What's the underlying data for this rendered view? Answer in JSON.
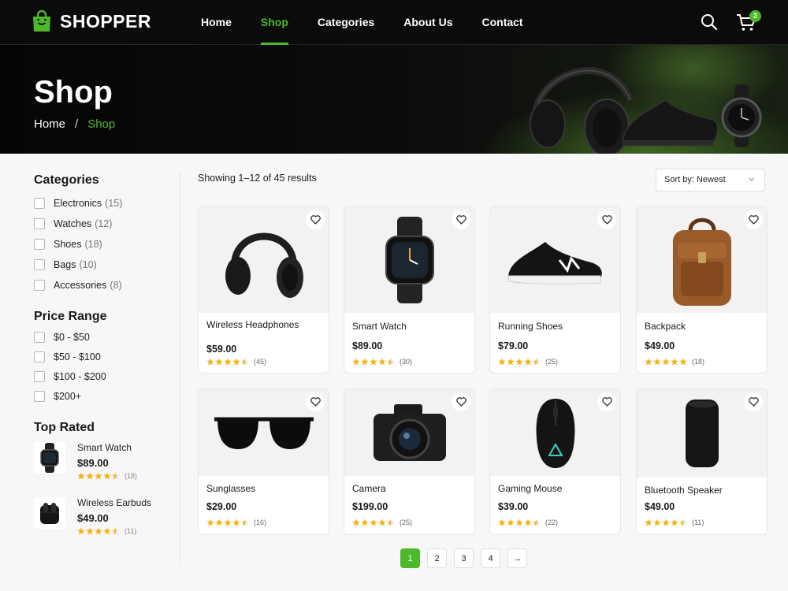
{
  "brand": {
    "name": "SHOPPER",
    "accent": "#4cb82c",
    "logo_icon": "shopping-bag-icon"
  },
  "nav": {
    "items": [
      "Home",
      "Shop",
      "Categories",
      "About Us",
      "Contact"
    ],
    "active": "Shop"
  },
  "header_icons": {
    "search": "search-icon",
    "cart": "cart-icon",
    "cart_count": "2"
  },
  "hero": {
    "title": "Shop",
    "breadcrumb": {
      "home": "Home",
      "separator": "/",
      "current": "Shop"
    }
  },
  "sidebar": {
    "categories_title": "Categories",
    "categories": [
      {
        "label": "Electronics",
        "count": "(15)"
      },
      {
        "label": "Watches",
        "count": "(12)"
      },
      {
        "label": "Shoes",
        "count": "(18)"
      },
      {
        "label": "Bags",
        "count": "(10)"
      },
      {
        "label": "Accessories",
        "count": "(8)"
      }
    ],
    "price_title": "Price Range",
    "prices": [
      "$0 - $50",
      "$50 - $100",
      "$100 - $200",
      "$200+"
    ],
    "top_rated_title": "Top Rated",
    "top_rated": [
      {
        "name": "Smart Watch",
        "price": "$89.00",
        "rating": 4.5,
        "reviews": "(18)",
        "icon": "smartwatch-icon"
      },
      {
        "name": "Wireless Earbuds",
        "price": "$49.00",
        "rating": 4.5,
        "reviews": "(11)",
        "icon": "earbuds-icon"
      }
    ]
  },
  "toolbar": {
    "showing": "Showing 1–12 of 45 results",
    "sort_label": "Sort by: Newest"
  },
  "products": [
    {
      "name": "Wireless Headphones",
      "price": "$59.00",
      "rating": 4.5,
      "reviews": "(45)",
      "icon": "headphones-icon"
    },
    {
      "name": "Smart Watch",
      "price": "$89.00",
      "rating": 4.5,
      "reviews": "(30)",
      "icon": "smartwatch-icon"
    },
    {
      "name": "Running Shoes",
      "price": "$79.00",
      "rating": 4.5,
      "reviews": "(25)",
      "icon": "sneaker-icon"
    },
    {
      "name": "Backpack",
      "price": "$49.00",
      "rating": 5,
      "reviews": "(18)",
      "icon": "backpack-icon"
    },
    {
      "name": "Sunglasses",
      "price": "$29.00",
      "rating": 4.5,
      "reviews": "(16)",
      "icon": "sunglasses-icon"
    },
    {
      "name": "Camera",
      "price": "$199.00",
      "rating": 4.5,
      "reviews": "(25)",
      "icon": "camera-icon"
    },
    {
      "name": "Gaming Mouse",
      "price": "$39.00",
      "rating": 4.5,
      "reviews": "(22)",
      "icon": "gaming-mouse-icon"
    },
    {
      "name": "Bluetooth Speaker",
      "price": "$49.00",
      "rating": 4.5,
      "reviews": "(11)",
      "icon": "speaker-icon"
    }
  ],
  "pagination": {
    "pages": [
      "1",
      "2",
      "3",
      "4"
    ],
    "active": "1",
    "next": "→"
  }
}
